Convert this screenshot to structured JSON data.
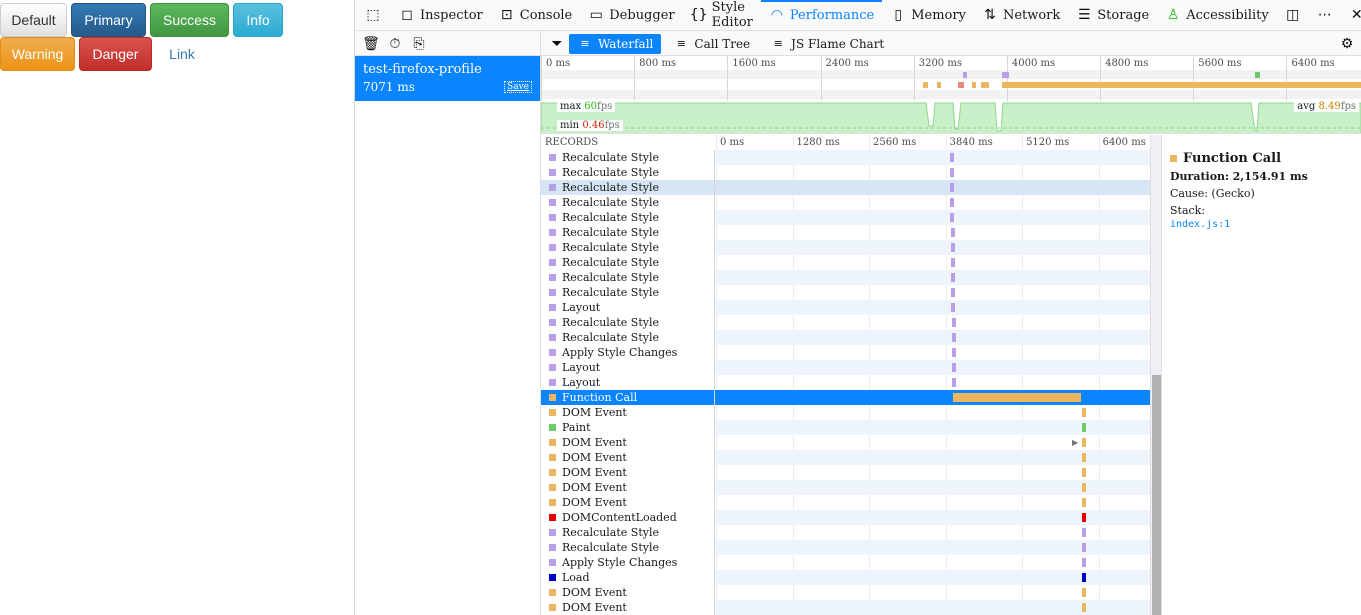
{
  "page": {
    "buttons": [
      {
        "label": "Default"
      },
      {
        "label": "Primary"
      },
      {
        "label": "Success"
      },
      {
        "label": "Info"
      },
      {
        "label": "Warning"
      },
      {
        "label": "Danger"
      },
      {
        "label": "Link"
      }
    ]
  },
  "toolbox": {
    "tabs": [
      {
        "label": "Inspector",
        "icon": "inspector-icon"
      },
      {
        "label": "Console",
        "icon": "console-icon"
      },
      {
        "label": "Debugger",
        "icon": "debugger-icon"
      },
      {
        "label": "Style Editor",
        "icon": "style-editor-icon"
      },
      {
        "label": "Performance",
        "icon": "performance-icon",
        "active": true
      },
      {
        "label": "Memory",
        "icon": "memory-icon"
      },
      {
        "label": "Network",
        "icon": "network-icon"
      },
      {
        "label": "Storage",
        "icon": "storage-icon"
      },
      {
        "label": "Accessibility",
        "icon": "accessibility-icon"
      }
    ]
  },
  "perf": {
    "view_tabs": [
      {
        "label": "Waterfall",
        "active": true
      },
      {
        "label": "Call Tree"
      },
      {
        "label": "JS Flame Chart"
      }
    ],
    "recording": {
      "name": "test-firefox-profile",
      "duration": "7071 ms",
      "save_label": "Save"
    },
    "overview_ticks": [
      "0 ms",
      "800 ms",
      "1600 ms",
      "2400 ms",
      "3200 ms",
      "4000 ms",
      "4800 ms",
      "5600 ms",
      "6400 ms"
    ],
    "fps": {
      "max_label": "max",
      "max_value": "60",
      "min_label": "min",
      "min_value": "0.46",
      "avg_label": "avg",
      "avg_value": "8.49",
      "unit": "fps"
    },
    "waterfall_header": {
      "records_label": "RECORDS",
      "ticks": [
        "0 ms",
        "1280 ms",
        "2560 ms",
        "3840 ms",
        "5120 ms",
        "6400 ms"
      ]
    },
    "records": [
      {
        "name": "Recalculate Style",
        "start": 3980,
        "dur": 40,
        "color": "#b99ee8"
      },
      {
        "name": "Recalculate Style",
        "start": 3980,
        "dur": 40,
        "color": "#b99ee8"
      },
      {
        "name": "Recalculate Style",
        "start": 3980,
        "dur": 40,
        "color": "#b99ee8"
      },
      {
        "name": "Recalculate Style",
        "start": 3985,
        "dur": 40,
        "color": "#b99ee8"
      },
      {
        "name": "Recalculate Style",
        "start": 3985,
        "dur": 40,
        "color": "#b99ee8"
      },
      {
        "name": "Recalculate Style",
        "start": 3990,
        "dur": 40,
        "color": "#b99ee8"
      },
      {
        "name": "Recalculate Style",
        "start": 3990,
        "dur": 40,
        "color": "#b99ee8"
      },
      {
        "name": "Recalculate Style",
        "start": 3995,
        "dur": 40,
        "color": "#b99ee8"
      },
      {
        "name": "Recalculate Style",
        "start": 3995,
        "dur": 40,
        "color": "#b99ee8"
      },
      {
        "name": "Recalculate Style",
        "start": 4000,
        "dur": 40,
        "color": "#b99ee8"
      },
      {
        "name": "Layout",
        "start": 4000,
        "dur": 40,
        "color": "#b99ee8"
      },
      {
        "name": "Recalculate Style",
        "start": 4010,
        "dur": 40,
        "color": "#b99ee8"
      },
      {
        "name": "Recalculate Style",
        "start": 4010,
        "dur": 40,
        "color": "#b99ee8"
      },
      {
        "name": "Apply Style Changes",
        "start": 4015,
        "dur": 40,
        "color": "#b99ee8"
      },
      {
        "name": "Layout",
        "start": 4015,
        "dur": 40,
        "color": "#b99ee8"
      },
      {
        "name": "Layout",
        "start": 4020,
        "dur": 40,
        "color": "#b99ee8"
      },
      {
        "name": "Function Call",
        "start": 4025,
        "dur": 2154.91,
        "color": "#ebb65e",
        "selected": true
      },
      {
        "name": "DOM Event",
        "start": 6190,
        "dur": 70,
        "color": "#ebb65e"
      },
      {
        "name": "Paint",
        "start": 6190,
        "dur": 70,
        "color": "#6ccc6c"
      },
      {
        "name": "DOM Event",
        "start": 6190,
        "dur": 70,
        "color": "#ebb65e",
        "has_children": true
      },
      {
        "name": "DOM Event",
        "start": 6190,
        "dur": 70,
        "color": "#ebb65e"
      },
      {
        "name": "DOM Event",
        "start": 6190,
        "dur": 70,
        "color": "#ebb65e"
      },
      {
        "name": "DOM Event",
        "start": 6190,
        "dur": 70,
        "color": "#ebb65e"
      },
      {
        "name": "DOM Event",
        "start": 6190,
        "dur": 70,
        "color": "#ebb65e"
      },
      {
        "name": "DOMContentLoaded",
        "start": 6190,
        "dur": 70,
        "color": "#e60000"
      },
      {
        "name": "Recalculate Style",
        "start": 6190,
        "dur": 70,
        "color": "#b99ee8"
      },
      {
        "name": "Recalculate Style",
        "start": 6190,
        "dur": 70,
        "color": "#b99ee8"
      },
      {
        "name": "Apply Style Changes",
        "start": 6190,
        "dur": 70,
        "color": "#b99ee8"
      },
      {
        "name": "Load",
        "start": 6190,
        "dur": 70,
        "color": "#0000cc"
      },
      {
        "name": "DOM Event",
        "start": 6190,
        "dur": 70,
        "color": "#ebb65e"
      },
      {
        "name": "DOM Event",
        "start": 6190,
        "dur": 70,
        "color": "#ebb65e"
      }
    ],
    "timeline_max_ms": 7260,
    "details": {
      "title": "Function Call",
      "duration_label": "Duration:",
      "duration_value": "2,154.91 ms",
      "cause_label": "Cause:",
      "cause_value": "(Gecko)",
      "stack_label": "Stack:",
      "stack_link": "index.js:1"
    }
  },
  "colors": {
    "accent": "#0a84ff",
    "js": "#ebb65e",
    "style": "#b99ee8",
    "paint": "#6ccc6c",
    "dcl": "#e60000",
    "load": "#0000cc"
  }
}
